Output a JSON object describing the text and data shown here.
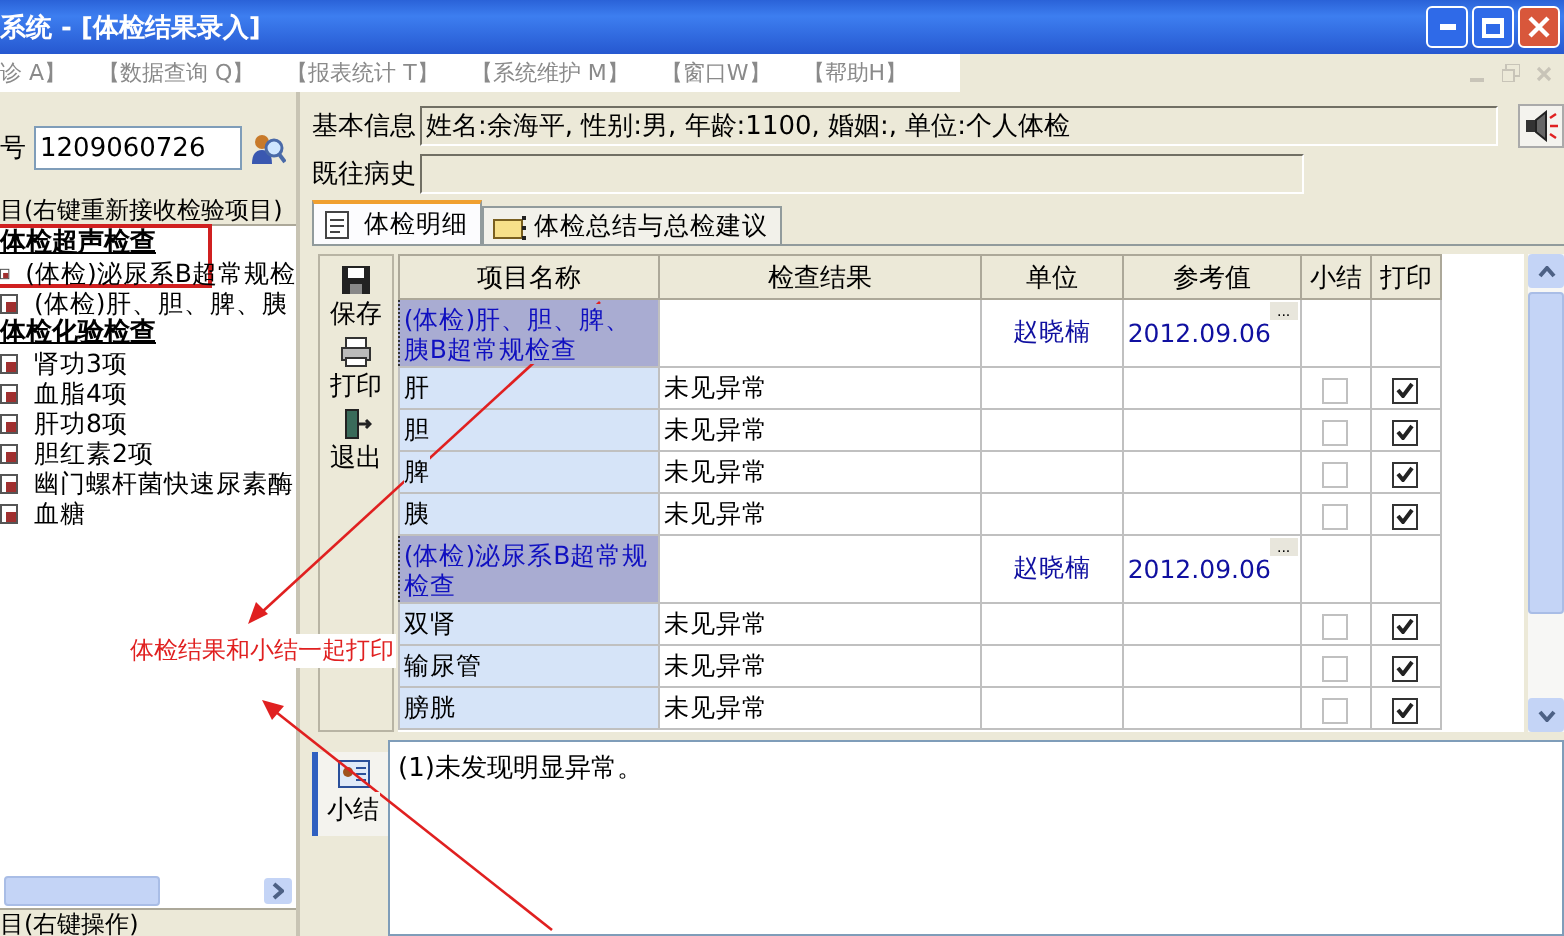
{
  "window": {
    "title": "系统 - [体检结果录入]"
  },
  "menu": [
    "诊 A】",
    "【数据查询 Q】",
    "【报表统计 T】",
    "【系统维护 M】",
    "【窗口W】",
    "【帮助H】"
  ],
  "left_panel": {
    "id_label": "号",
    "id_value": "1209060726",
    "tree_header": "目(右键重新接收检验项目)",
    "tree": [
      {
        "label": "体检超声检查",
        "children": [
          {
            "label": "(体检)泌尿系B超常规检"
          },
          {
            "label": "(体检)肝、胆、脾、胰"
          }
        ]
      },
      {
        "label": "体检化验检查",
        "children": [
          {
            "label": "肾功3项"
          },
          {
            "label": "血脂4项"
          },
          {
            "label": "肝功8项"
          },
          {
            "label": "胆红素2项"
          },
          {
            "label": "幽门螺杆菌快速尿素酶"
          },
          {
            "label": "血糖"
          }
        ]
      }
    ],
    "bottom_header": "目(右键操作)"
  },
  "info": {
    "basic_label": "基本信息",
    "basic_value": "姓名:余海平, 性别:男, 年龄:1100, 婚姻:, 单位:个人体检",
    "history_label": "既往病史"
  },
  "tabs": [
    {
      "label": "体检明细",
      "selected": true
    },
    {
      "label": "体检总结与总检建议",
      "selected": false
    }
  ],
  "toolbar": [
    "保存",
    "打印",
    "退出"
  ],
  "table": {
    "columns": [
      "项目名称",
      "检查结果",
      "单位",
      "参考值",
      "小结",
      "打印"
    ],
    "rows": [
      {
        "kind": "group",
        "name": "(体检)肝、胆、脾、胰B超常规检查",
        "unit": "赵晓楠",
        "reference": "2012.09.06",
        "more": "..."
      },
      {
        "kind": "item",
        "name": "肝",
        "result": "未见异常",
        "summary": false,
        "print": true
      },
      {
        "kind": "item",
        "name": "胆",
        "result": "未见异常",
        "summary": false,
        "print": true
      },
      {
        "kind": "item",
        "name": "脾",
        "result": "未见异常",
        "summary": false,
        "print": true
      },
      {
        "kind": "item",
        "name": "胰",
        "result": "未见异常",
        "summary": false,
        "print": true
      },
      {
        "kind": "group",
        "name": "(体检)泌尿系B超常规检查",
        "unit": "赵晓楠",
        "reference": "2012.09.06",
        "more": "..."
      },
      {
        "kind": "item",
        "name": "双肾",
        "result": "未见异常",
        "summary": false,
        "print": true
      },
      {
        "kind": "item",
        "name": "输尿管",
        "result": "未见异常",
        "summary": false,
        "print": true
      },
      {
        "kind": "item",
        "name": "膀胱",
        "result": "未见异常",
        "summary": false,
        "print": true
      }
    ]
  },
  "summary": {
    "tab": "小结",
    "text": "(1)未发现明显异常。"
  },
  "annotation": {
    "text": "体检结果和小结一起打印"
  }
}
